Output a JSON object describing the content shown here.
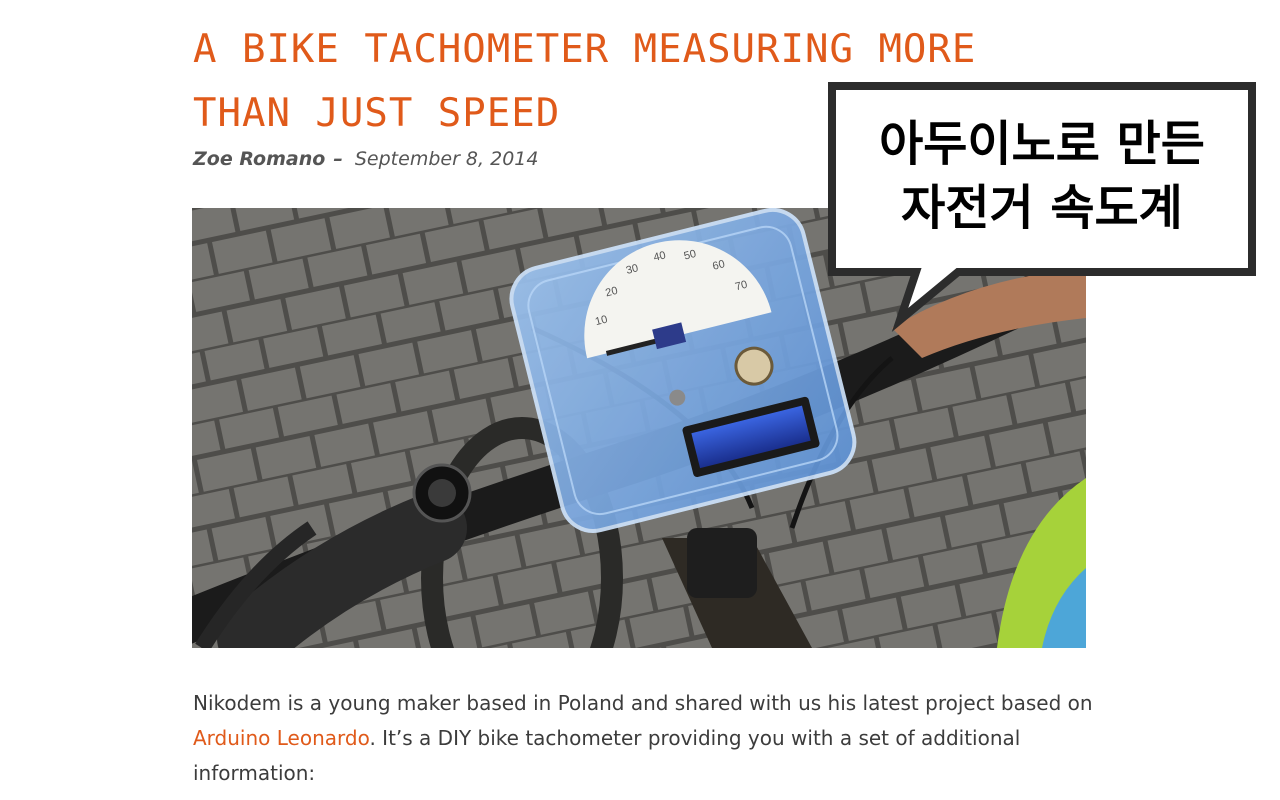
{
  "article": {
    "title_line1": "A BIKE TACHOMETER MEASURING MORE",
    "title_line2": "THAN JUST SPEED",
    "author": "Zoe Romano",
    "separator": "–",
    "date": "September 8, 2014",
    "paragraph_part1": "Nikodem is a young maker  based in Poland and shared with us his latest project based on ",
    "link_text": "Arduino Leonardo",
    "paragraph_part2": ". It’s a DIY bike tachometer providing you with a set of additional information:"
  },
  "photo": {
    "gauge_ticks": [
      "10",
      "20",
      "30",
      "40",
      "50",
      "60",
      "70"
    ]
  },
  "callout": {
    "line1": "아두이노로 만든",
    "line2": "자전거 속도계"
  },
  "colors": {
    "accent": "#e05a1a",
    "text": "#3c3c3c",
    "byline": "#555555"
  }
}
